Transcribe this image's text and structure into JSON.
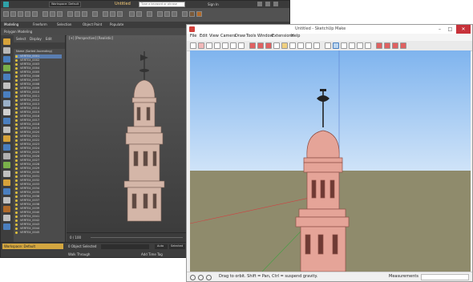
{
  "max": {
    "title": "Untitled",
    "workspace_select": "Workspace: Default",
    "search_placeholder": "Type a keyword or phrase",
    "signin": "Sign In",
    "ribbon_tabs": [
      "Modeling",
      "Freeform",
      "Selection",
      "Object Paint",
      "Populate"
    ],
    "ribbon_sub": "Polygon Modeling",
    "explorer_tabs": [
      "Select",
      "Display",
      "Edit"
    ],
    "explorer_header": "Name (Sorted Ascending)",
    "explorer_items": [
      "VERTEX_0001",
      "VERTEX_0002",
      "VERTEX_0003",
      "VERTEX_0004",
      "VERTEX_0005",
      "VERTEX_0006",
      "VERTEX_0007",
      "VERTEX_0008",
      "VERTEX_0009",
      "VERTEX_0010",
      "VERTEX_0011",
      "VERTEX_0012",
      "VERTEX_0013",
      "VERTEX_0014",
      "VERTEX_0015",
      "VERTEX_0016",
      "VERTEX_0017",
      "VERTEX_0018",
      "VERTEX_0019",
      "VERTEX_0020",
      "VERTEX_0021",
      "VERTEX_0022",
      "VERTEX_0023",
      "VERTEX_0024",
      "VERTEX_0025",
      "VERTEX_0026",
      "VERTEX_0027",
      "VERTEX_0028",
      "VERTEX_0029",
      "VERTEX_0030",
      "VERTEX_0031",
      "VERTEX_0032",
      "VERTEX_0033",
      "VERTEX_0034",
      "VERTEX_0035",
      "VERTEX_0036",
      "VERTEX_0037",
      "VERTEX_0038",
      "VERTEX_0039",
      "VERTEX_0040",
      "VERTEX_0041",
      "VERTEX_0042",
      "VERTEX_0043",
      "VERTEX_0044",
      "VERTEX_0045"
    ],
    "viewport_label": "[+] [Perspective] [Realistic]",
    "timeline_label": "0 / 100",
    "workspace_status": "Workspace: Default",
    "status_selected": "0 Object Selected",
    "status_walk": "Walk Through",
    "status_addtime": "Add Time Tag",
    "status_auto": "Auto",
    "status_selected_btn": "Selected"
  },
  "sku": {
    "title": "Untitled - SketchUp Make",
    "menu": [
      "File",
      "Edit",
      "View",
      "Camera",
      "Draw",
      "Tools",
      "Window",
      "Extensions",
      "Help"
    ],
    "status_hint": "Drag to orbit. Shift = Pan, Ctrl = suspend gravity.",
    "measurements_label": "Measurements"
  },
  "colors": {
    "tower": "#e5a498",
    "tower_dark": "#8e4f46",
    "max_tower": "#d4b6a8"
  }
}
